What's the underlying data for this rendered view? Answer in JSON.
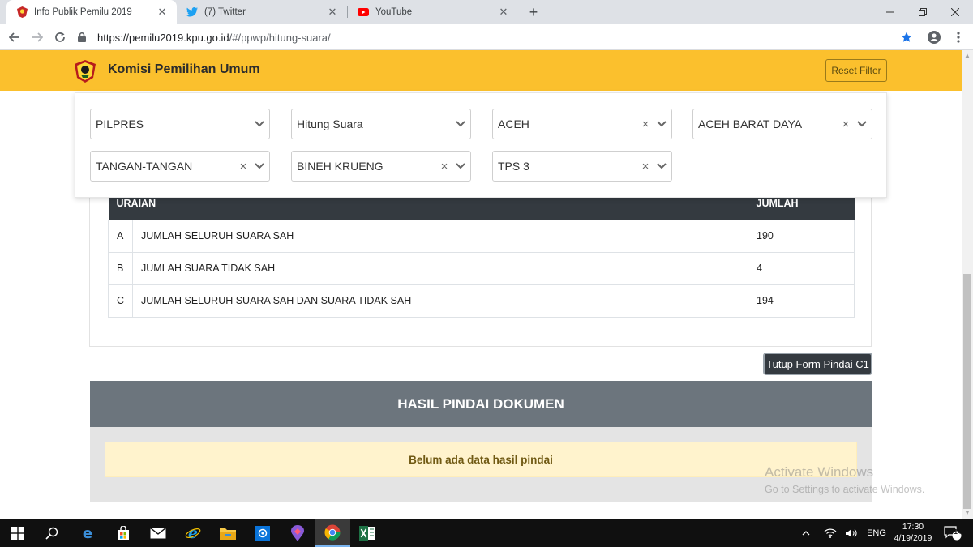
{
  "browser": {
    "tabs": [
      {
        "label": "Info Publik Pemilu 2019",
        "icon": "kpu-favicon",
        "active": true
      },
      {
        "label": "(7) Twitter",
        "icon": "twitter-icon",
        "active": false
      },
      {
        "label": "YouTube",
        "icon": "youtube-icon",
        "active": false
      }
    ],
    "close_glyph": "✕",
    "newtab_glyph": "+",
    "url_host": "https://pemilu2019.kpu.go.id",
    "url_path": "/#/ppwp/hitung-suara/"
  },
  "header": {
    "title": "Komisi Pemilihan Umum",
    "reset_label": "Reset Filter",
    "color": "#fbc02d"
  },
  "filters": {
    "row1": [
      "PILPRES",
      "Hitung Suara",
      "ACEH",
      "ACEH BARAT DAYA"
    ],
    "row2": [
      "TANGAN-TANGAN",
      "BINEH KRUENG",
      "TPS 3"
    ],
    "clear_glyph": "×"
  },
  "results": {
    "headers": {
      "uraian": "URAIAN",
      "jumlah": "JUMLAH"
    },
    "rows": [
      {
        "idx": "A",
        "label": "JUMLAH SELURUH SUARA SAH",
        "value": "190"
      },
      {
        "idx": "B",
        "label": "JUMLAH SUARA TIDAK SAH",
        "value": "4"
      },
      {
        "idx": "C",
        "label": "JUMLAH SELURUH SUARA SAH DAN SUARA TIDAK SAH",
        "value": "194"
      }
    ]
  },
  "scan": {
    "toggle_label": "Tutup Form Pindai C1",
    "title": "HASIL PINDAI DOKUMEN",
    "empty_message": "Belum ada data hasil pindai"
  },
  "watermark": {
    "line1": "Activate Windows",
    "line2": "Go to Settings to activate Windows."
  },
  "taskbar": {
    "lang": "ENG",
    "time": "17:30",
    "date": "4/19/2019",
    "notifications": "14"
  }
}
